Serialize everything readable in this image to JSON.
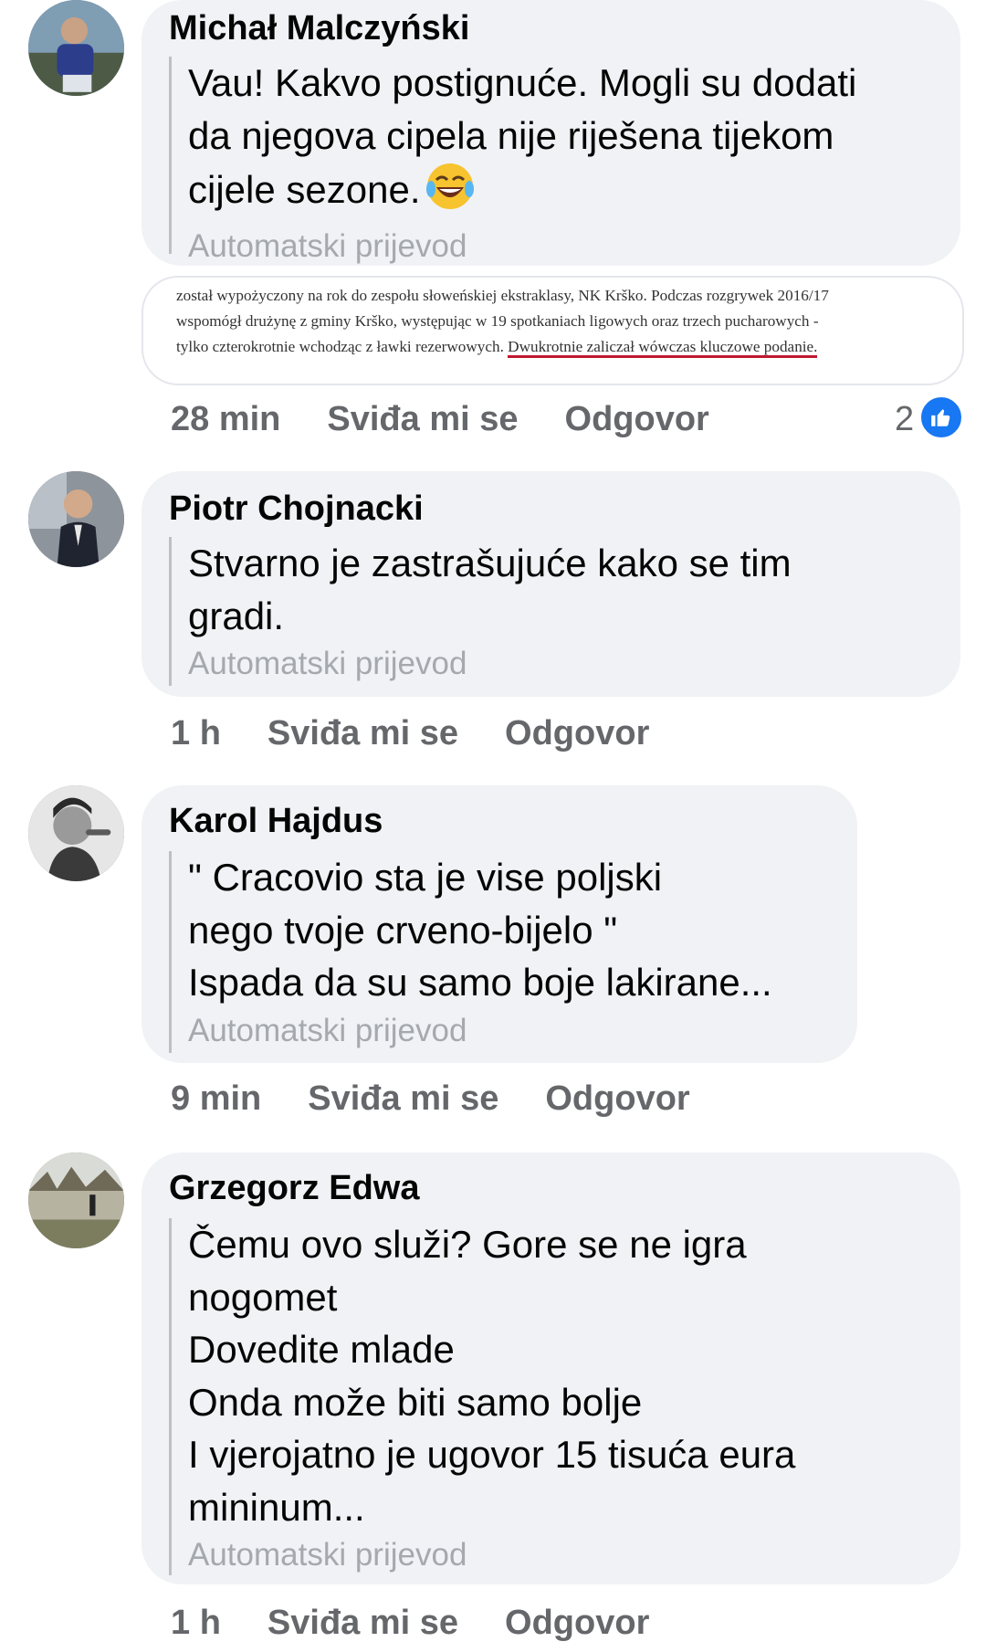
{
  "comments": [
    {
      "author": "Michał Malczyński",
      "lines": [
        "Vau! Kakvo postignuće. Mogli su dodati",
        "da njegova cipela nije riješena tijekom",
        "cijele sezone."
      ],
      "emoji": "laughing-tears-emoji",
      "translated_label": "Automatski prijevod",
      "attachment": {
        "lines": [
          "został wypożyczony na rok do zespołu słoweńskiej ekstraklasy, NK Krško. Podczas rozgrywek 2016/17",
          "wspomógł drużynę z gminy Krško, występując w 19 spotkaniach ligowych oraz trzech pucharowych -",
          "tylko czterokrotnie wchodząc z ławki rezerwowych."
        ],
        "highlight": "Dwukrotnie zaliczał wówczas kluczowe podanie."
      },
      "time": "28 min",
      "like_label": "Sviđa mi se",
      "reply_label": "Odgovor",
      "reaction_count": "2",
      "reaction_icon": "thumbs-up-icon"
    },
    {
      "author": "Piotr Chojnacki",
      "lines": [
        "Stvarno je zastrašujuće kako se tim",
        "gradi."
      ],
      "translated_label": "Automatski prijevod",
      "time": "1 h",
      "like_label": "Sviđa mi se",
      "reply_label": "Odgovor"
    },
    {
      "author": "Karol Hajdus",
      "lines": [
        "\" Cracovio sta je vise poljski",
        "nego tvoje crveno-bijelo \"",
        "Ispada da su samo boje lakirane..."
      ],
      "translated_label": "Automatski prijevod",
      "time": "9 min",
      "like_label": "Sviđa mi se",
      "reply_label": "Odgovor"
    },
    {
      "author": "Grzegorz Edwa",
      "lines": [
        "Čemu ovo služi? Gore se ne igra",
        "nogomet",
        "Dovedite mlade",
        "Onda može biti samo bolje",
        "I vjerojatno je ugovor 15 tisuća eura",
        "mininum..."
      ],
      "translated_label": "Automatski prijevod",
      "time": "1 h",
      "like_label": "Sviđa mi se",
      "reply_label": "Odgovor"
    }
  ],
  "colors": {
    "bubble": "#f0f2f5",
    "meta_text": "#65676b",
    "translated_text": "#a5a9ae",
    "like_blue": "#1877f2",
    "highlight_underline": "#c0182f"
  }
}
